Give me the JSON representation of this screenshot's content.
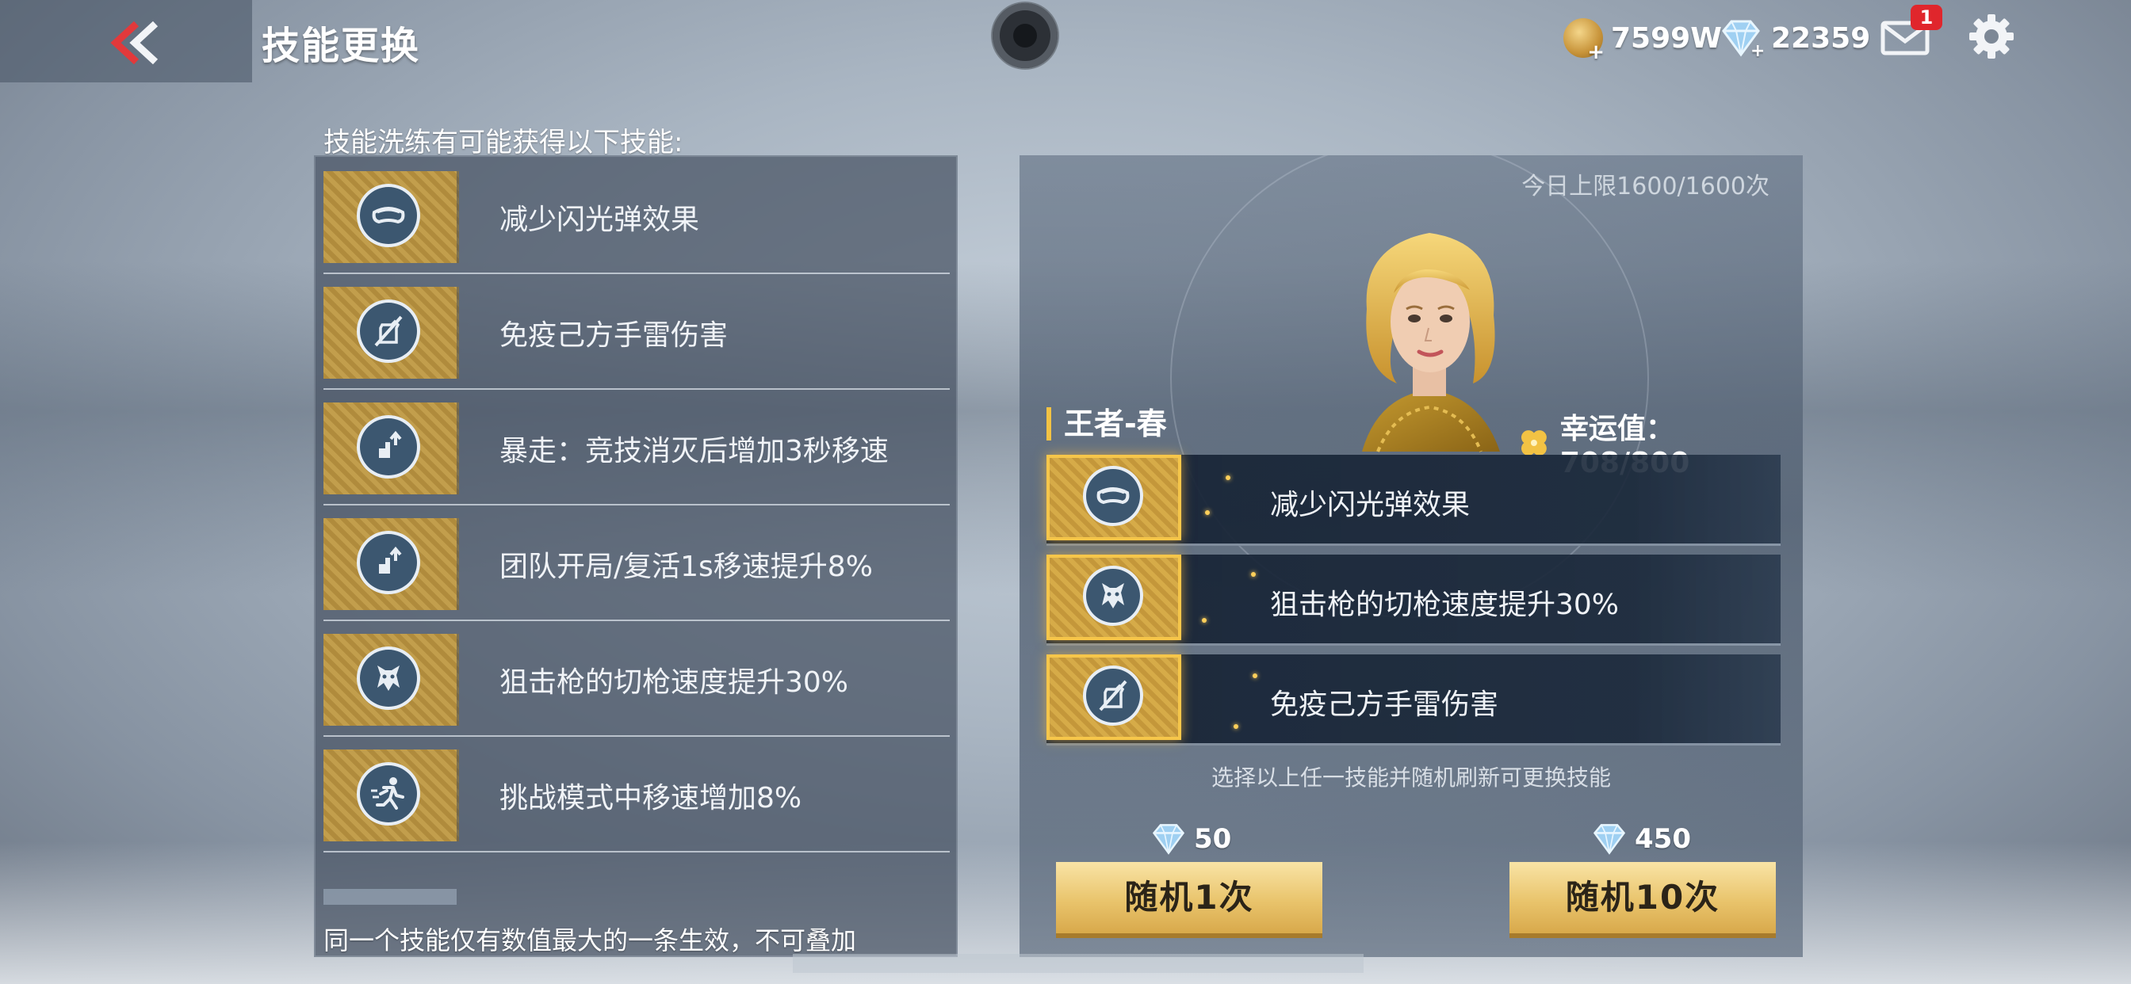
{
  "header": {
    "title": "技能更换",
    "gold": "7599W",
    "gems": "22359",
    "mail_badge": "1"
  },
  "skill_pool": {
    "caption": "技能洗练有可能获得以下技能:",
    "items": [
      {
        "label": "减少闪光弹效果",
        "icon": "goggles-icon"
      },
      {
        "label": "免疫己方手雷伤害",
        "icon": "grenade-immune-icon"
      },
      {
        "label": "暴走：竞技消灭后增加3秒移速",
        "icon": "speed-boost-icon"
      },
      {
        "label": "团队开局/复活1s移速提升8%",
        "icon": "speed-boost-icon"
      },
      {
        "label": "狙击枪的切枪速度提升30%",
        "icon": "wolf-emblem-icon"
      },
      {
        "label": "挑战模式中移速增加8%",
        "icon": "running-man-icon"
      }
    ],
    "footer": "同一个技能仅有数值最大的一条生效，不可叠加"
  },
  "character": {
    "daily_limit": "今日上限1600/1600次",
    "name": "王者-春",
    "luck": "幸运值：708/800",
    "slots": [
      {
        "label": "减少闪光弹效果",
        "icon": "goggles-icon"
      },
      {
        "label": "狙击枪的切枪速度提升30%",
        "icon": "wolf-emblem-icon"
      },
      {
        "label": "免疫己方手雷伤害",
        "icon": "grenade-immune-icon"
      }
    ],
    "hint": "选择以上任一技能并随机刷新可更换技能",
    "roll_once": {
      "cost": "50",
      "label": "随机1次"
    },
    "roll_ten": {
      "cost": "450",
      "label": "随机10次"
    }
  },
  "colors": {
    "accent_gold": "#f2c244",
    "badge_red": "#e0262c",
    "back_red": "#e2393b"
  }
}
